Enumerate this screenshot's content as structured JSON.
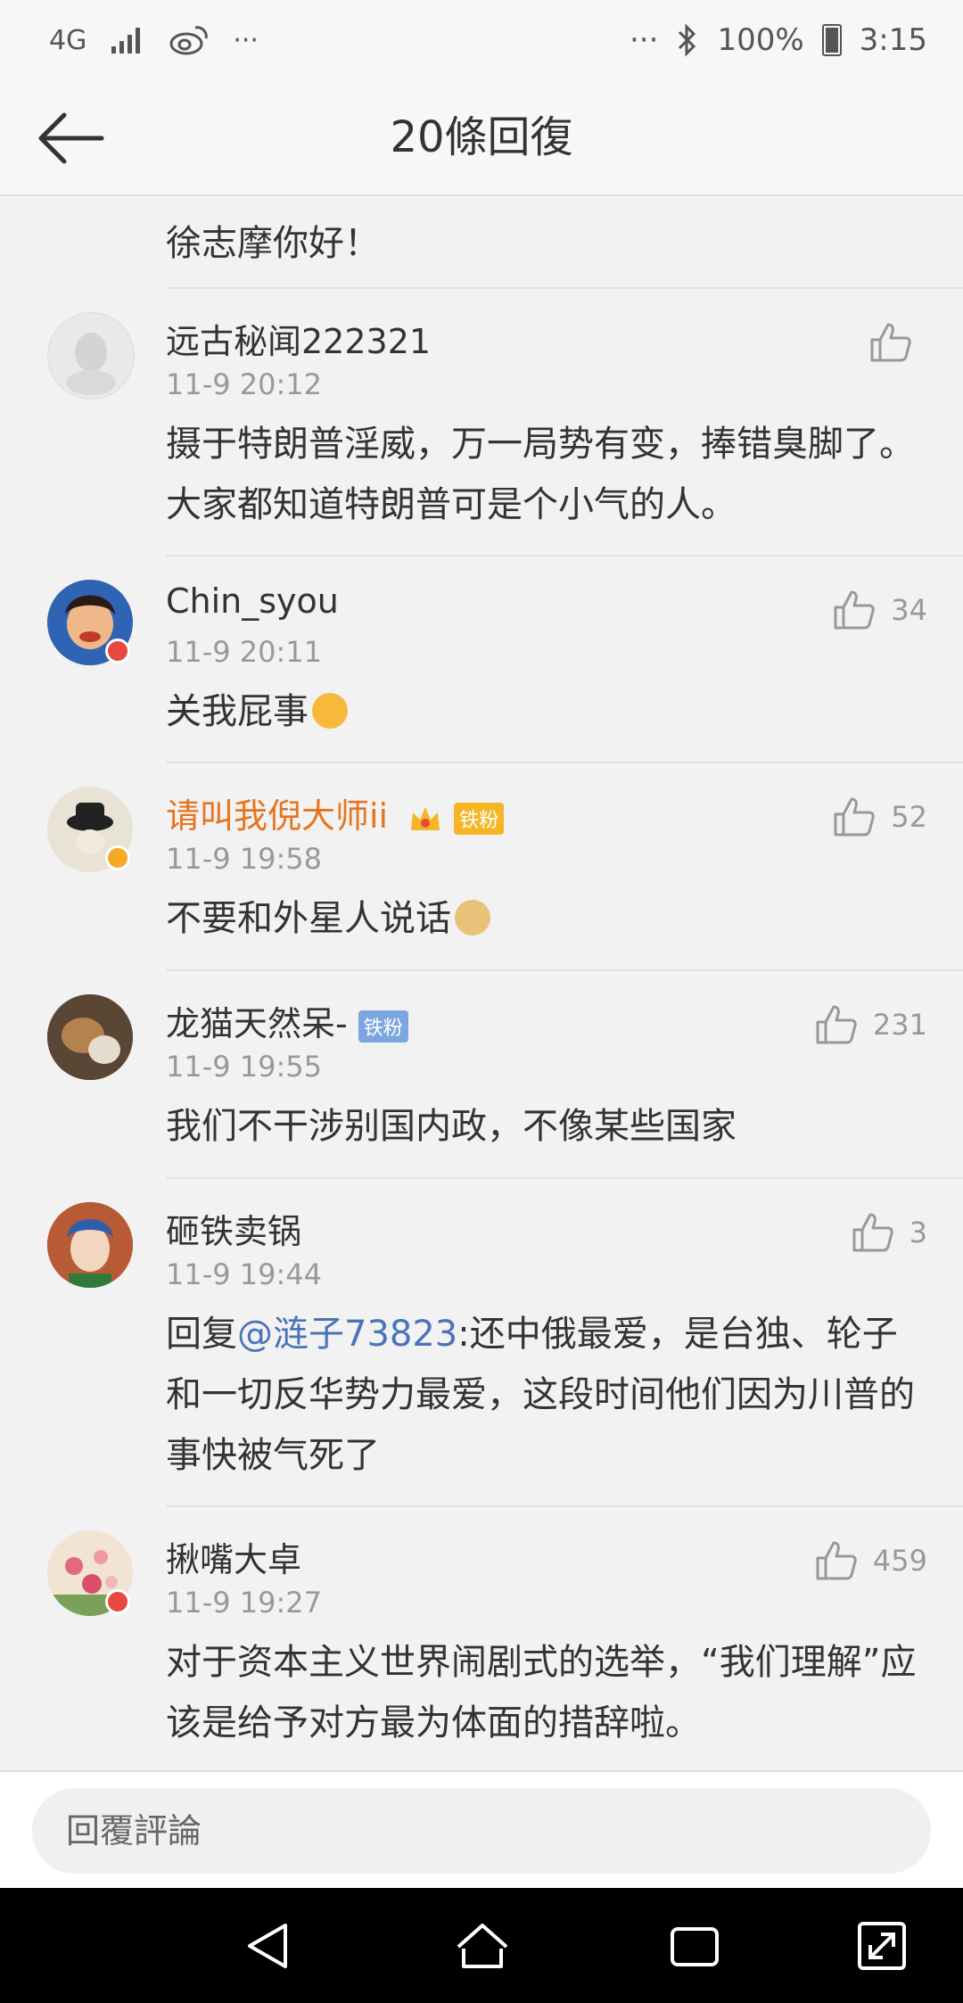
{
  "status_bar": {
    "network": "4G",
    "more": "···",
    "battery": "100%",
    "time": "3:15"
  },
  "header": {
    "title": "20條回復"
  },
  "first_reply": {
    "text": "徐志摩你好！"
  },
  "comments": [
    {
      "name": "远古秘闻222321",
      "time": "11-9 20:12",
      "likes": "",
      "body": "摄于特朗普淫威，万一局势有变，捧错臭脚了。大家都知道特朗普可是个小气的人。"
    },
    {
      "name": "Chin_syou",
      "time": "11-9 20:11",
      "likes": "34",
      "body": "关我屁事"
    },
    {
      "name": "请叫我倪大师ii",
      "tag": "铁粉",
      "time": "11-9 19:58",
      "likes": "52",
      "body": "不要和外星人说话"
    },
    {
      "name": "龙猫天然呆-",
      "tag": "铁粉",
      "time": "11-9 19:55",
      "likes": "231",
      "body": "我们不干涉别国内政，不像某些国家"
    },
    {
      "name": "砸铁卖锅",
      "time": "11-9 19:44",
      "likes": "3",
      "body_prefix": "回复",
      "mention": "@涟子73823",
      "body": ":还中俄最爱，是台独、轮子和一切反华势力最爱，这段时间他们因为川普的事快被气死了"
    },
    {
      "name": "揪嘴大卓",
      "time": "11-9 19:27",
      "likes": "459",
      "body": "对于资本主义世界闹剧式的选举，“我们理解”应该是给予对方最为体面的措辞啦。"
    }
  ],
  "reply_bar": {
    "placeholder": "回覆評論"
  },
  "colors": {
    "orange_name": "#e8741e",
    "mention": "#4a74b8",
    "badge_red": "#e8483f",
    "badge_gold": "#f4a824"
  },
  "icons": [
    "back-arrow-icon",
    "thumbs-up-icon",
    "nav-back-icon",
    "nav-home-icon",
    "nav-recents-icon",
    "nav-rotate-icon",
    "bluetooth-icon",
    "weibo-icon",
    "signal-icon"
  ]
}
